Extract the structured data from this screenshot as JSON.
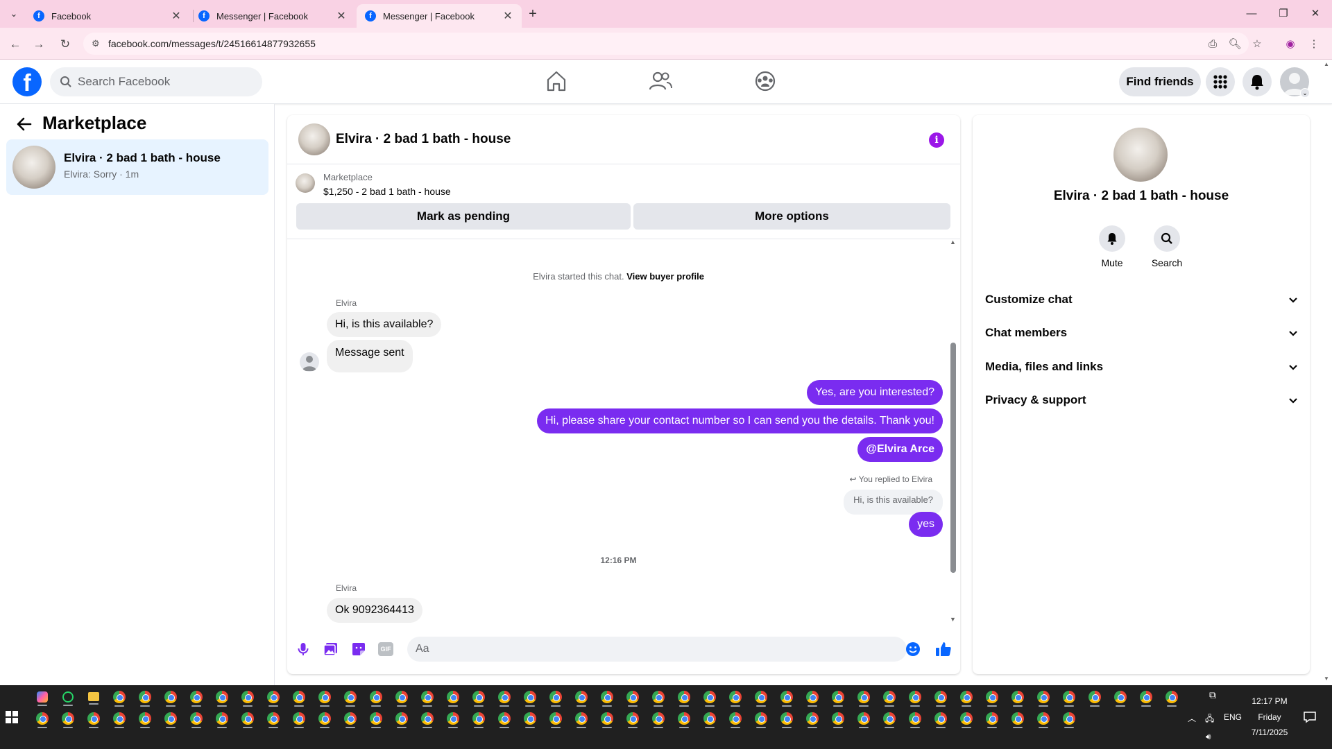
{
  "browser": {
    "tabs": [
      {
        "label": "Facebook",
        "active": false
      },
      {
        "label": "Messenger | Facebook",
        "active": false
      },
      {
        "label": "Messenger | Facebook",
        "active": true
      }
    ],
    "url": "facebook.com/messages/t/24516614877932655"
  },
  "fb": {
    "logo_letter": "f",
    "search_placeholder": "Search Facebook",
    "find_friends": "Find friends",
    "brand_color": "#0866ff"
  },
  "left": {
    "title": "Marketplace",
    "conversation": {
      "name": "Elvira · 2 bad 1 bath - house",
      "preview": "Elvira: Sorry · 1m"
    }
  },
  "chat": {
    "title": "Elvira · 2 bad 1 bath - house",
    "listing": {
      "category": "Marketplace",
      "detail": "$1,250 - 2 bad 1 bath - house"
    },
    "buttons": {
      "pending": "Mark as pending",
      "more": "More options"
    },
    "started_text": "Elvira started this chat.",
    "buyer_profile_link": "View buyer profile",
    "sender_name": "Elvira",
    "incoming_1": "Hi, is this available?",
    "incoming_2": "Message sent",
    "outgoing_1": "Yes, are you interested?",
    "outgoing_2": "Hi, please share your contact number so I can send you the details. Thank you!",
    "outgoing_3": "@Elvira Arce",
    "replied_label": "You replied to Elvira",
    "quoted": "Hi, is this available?",
    "outgoing_4": "yes",
    "timestamp": "12:16 PM",
    "sender_name_2": "Elvira",
    "incoming_3": "Ok 9092364413",
    "composer_placeholder": "Aa",
    "accent_color": "#7a2cf0"
  },
  "right": {
    "name": "Elvira · 2 bad 1 bath - house",
    "actions": {
      "mute": "Mute",
      "search": "Search"
    },
    "sections": [
      "Customize chat",
      "Chat members",
      "Media, files and links",
      "Privacy & support"
    ]
  },
  "taskbar": {
    "time": "12:17 PM",
    "day": "Friday",
    "date": "7/11/2025",
    "lang": "ENG"
  }
}
